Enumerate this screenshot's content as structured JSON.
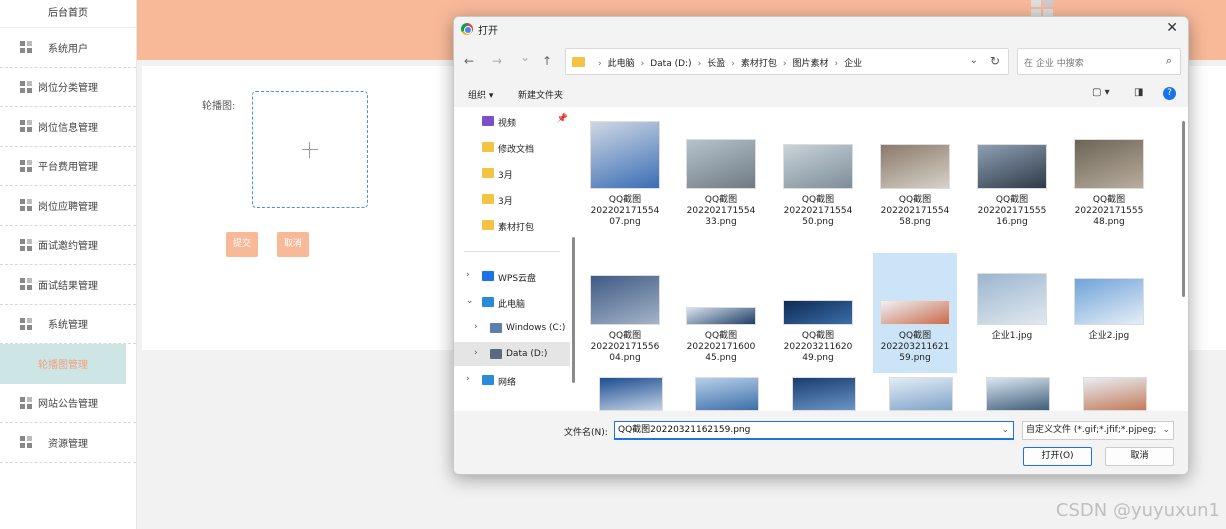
{
  "app": {
    "sidebar": {
      "home": "后台首页",
      "items": [
        {
          "label": "系统用户"
        },
        {
          "label": "岗位分类管理"
        },
        {
          "label": "岗位信息管理"
        },
        {
          "label": "平台费用管理"
        },
        {
          "label": "岗位应聘管理"
        },
        {
          "label": "面试邀约管理"
        },
        {
          "label": "面试结果管理"
        },
        {
          "label": "系统管理"
        },
        {
          "label": "轮播图管理"
        },
        {
          "label": "网站公告管理"
        },
        {
          "label": "资源管理"
        }
      ],
      "active_index": 8
    },
    "form": {
      "carousel_label": "轮播图:",
      "submit": "提交",
      "cancel": "取消"
    },
    "colors": {
      "accent": "#f8b999",
      "active_bg": "#cde5e4"
    }
  },
  "dialog": {
    "title": "打开",
    "close": "✕",
    "nav": {
      "back": "←",
      "forward": "→",
      "down": "⌄",
      "up": "↑"
    },
    "breadcrumb": [
      "此电脑",
      "Data (D:)",
      "长盈",
      "素材打包",
      "图片素材",
      "企业"
    ],
    "search_placeholder": "在 企业 中搜索",
    "toolbar": {
      "organize": "组织 ▾",
      "new_folder": "新建文件夹",
      "help": "?"
    },
    "nav_pane": [
      {
        "label": "视频",
        "icon": "video-icon",
        "color": "#7b4fc9",
        "pinned": true
      },
      {
        "label": "修改文档",
        "icon": "folder-icon",
        "color": "#f5c343"
      },
      {
        "label": "3月",
        "icon": "folder-icon",
        "color": "#f5c343"
      },
      {
        "label": "3月",
        "icon": "folder-icon",
        "color": "#f5c343"
      },
      {
        "label": "素材打包",
        "icon": "folder-icon",
        "color": "#f5c343"
      },
      {
        "label": "WPS云盘",
        "icon": "cloud-icon",
        "color": "#1a73e8",
        "expand": "›"
      },
      {
        "label": "此电脑",
        "icon": "computer-icon",
        "color": "#2a8bd8",
        "expand": "⌄"
      },
      {
        "label": "Windows (C:)",
        "icon": "drive-icon",
        "color": "#5a7fa8",
        "expand": "›"
      },
      {
        "label": "Data (D:)",
        "icon": "drive-icon",
        "color": "#5a6b7d",
        "expand": "›",
        "selected": true
      },
      {
        "label": "网络",
        "icon": "network-icon",
        "color": "#2a8bd8",
        "expand": "›"
      }
    ],
    "files": [
      {
        "name": "QQ截图20220217155407.png",
        "l1": "QQ截图",
        "l2": "202202171554",
        "l3": "07.png"
      },
      {
        "name": "QQ截图20220217155433.png",
        "l1": "QQ截图",
        "l2": "202202171554",
        "l3": "33.png"
      },
      {
        "name": "QQ截图20220217155450.png",
        "l1": "QQ截图",
        "l2": "202202171554",
        "l3": "50.png"
      },
      {
        "name": "QQ截图20220217155458.png",
        "l1": "QQ截图",
        "l2": "202202171554",
        "l3": "58.png"
      },
      {
        "name": "QQ截图20220217155516.png",
        "l1": "QQ截图",
        "l2": "202202171555",
        "l3": "16.png"
      },
      {
        "name": "QQ截图20220217155548.png",
        "l1": "QQ截图",
        "l2": "202202171555",
        "l3": "48.png"
      },
      {
        "name": "QQ截图20220217155604.png",
        "l1": "QQ截图",
        "l2": "202202171556",
        "l3": "04.png"
      },
      {
        "name": "QQ截图20220217160045.png",
        "l1": "QQ截图",
        "l2": "202202171600",
        "l3": "45.png"
      },
      {
        "name": "QQ截图20220321162049.png",
        "l1": "QQ截图",
        "l2": "202203211620",
        "l3": "49.png"
      },
      {
        "name": "QQ截图20220321162159.png",
        "l1": "QQ截图",
        "l2": "202203211621",
        "l3": "59.png",
        "selected": true
      },
      {
        "name": "企业1.jpg",
        "l1": "企业1.jpg",
        "l2": "",
        "l3": ""
      },
      {
        "name": "企业2.jpg",
        "l1": "企业2.jpg",
        "l2": "",
        "l3": ""
      }
    ],
    "filename_label": "文件名(N):",
    "filename_value": "QQ截图20220321162159.png",
    "filter": "自定义文件 (*.gif;*.jfif;*.pjpeg;",
    "open_button": "打开(O)",
    "cancel_button": "取消"
  },
  "watermark": "CSDN @yuyuxun1"
}
